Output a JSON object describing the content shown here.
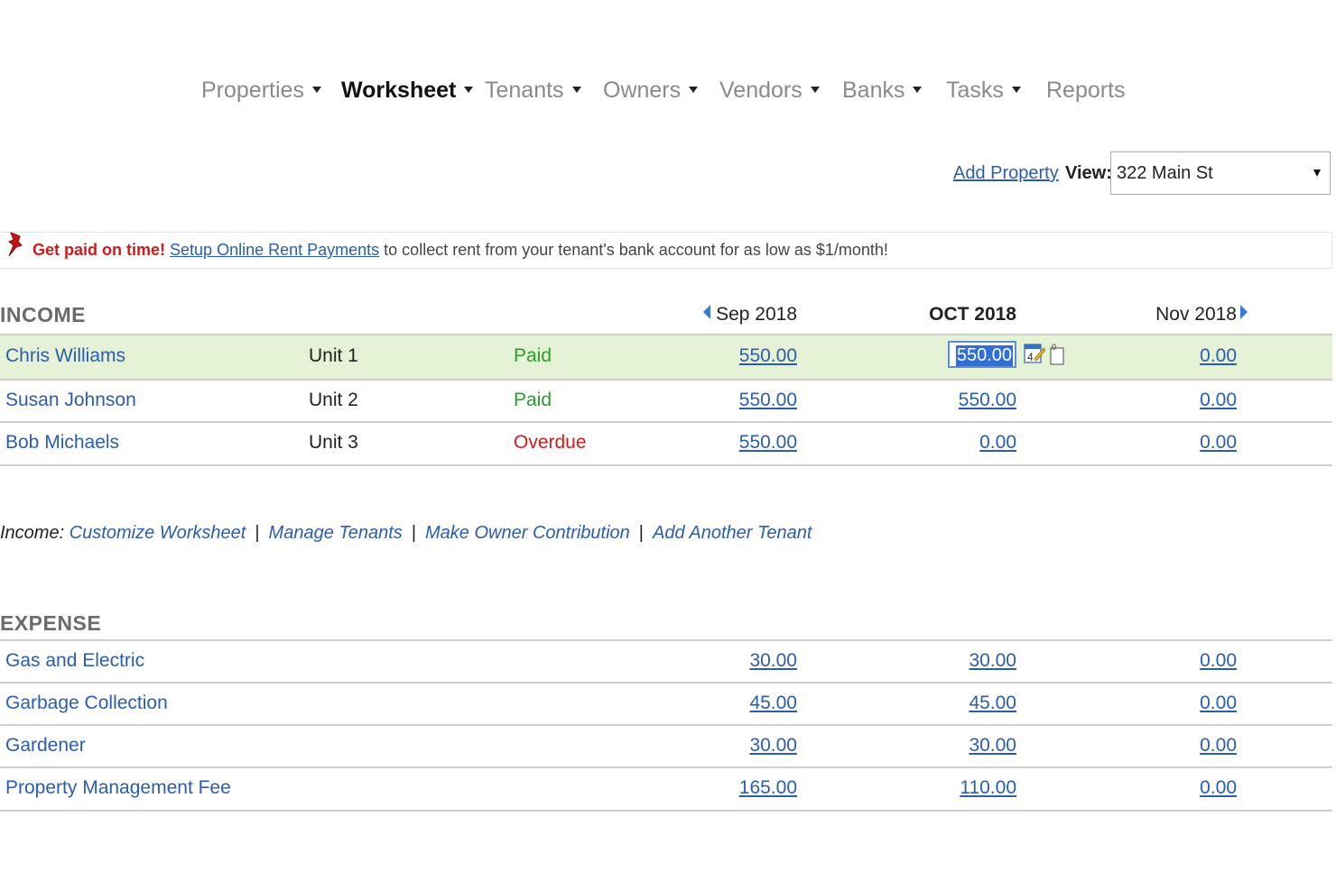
{
  "nav": {
    "items": [
      {
        "label": "Properties",
        "dropdown": true,
        "active": false
      },
      {
        "label": "Worksheet",
        "dropdown": true,
        "active": true
      },
      {
        "label": "Tenants",
        "dropdown": true,
        "active": false
      },
      {
        "label": "Owners",
        "dropdown": true,
        "active": false
      },
      {
        "label": "Vendors",
        "dropdown": true,
        "active": false
      },
      {
        "label": "Banks",
        "dropdown": true,
        "active": false
      },
      {
        "label": "Tasks",
        "dropdown": true,
        "active": false
      },
      {
        "label": "Reports",
        "dropdown": false,
        "active": false
      }
    ]
  },
  "toolbar": {
    "add_property": "Add Property",
    "view_label": "View:",
    "view_value": "322 Main St"
  },
  "banner": {
    "strong": "Get paid on time!",
    "link": "Setup Online Rent Payments",
    "rest": " to collect rent from your tenant's bank account for as low as $1/month!"
  },
  "income": {
    "title": "INCOME",
    "months": {
      "prev": "Sep 2018",
      "current": "OCT 2018",
      "next": "Nov 2018"
    },
    "rows": [
      {
        "name": "Chris Williams",
        "unit": "Unit 1",
        "status": "Paid",
        "sep": "550.00",
        "oct": "550.00",
        "nov": "0.00",
        "calendar_day": "4",
        "doc_count": "0"
      },
      {
        "name": "Susan Johnson",
        "unit": "Unit 2",
        "status": "Paid",
        "sep": "550.00",
        "oct": "550.00",
        "nov": "0.00"
      },
      {
        "name": "Bob Michaels",
        "unit": "Unit 3",
        "status": "Overdue",
        "sep": "550.00",
        "oct": "0.00",
        "nov": "0.00"
      }
    ],
    "links": {
      "prefix": "Income:",
      "items": [
        "Customize Worksheet",
        "Manage Tenants",
        "Make Owner Contribution",
        "Add Another Tenant"
      ],
      "separator": "|"
    }
  },
  "expense": {
    "title": "EXPENSE",
    "rows": [
      {
        "name": "Gas and Electric",
        "sep": "30.00",
        "oct": "30.00",
        "nov": "0.00"
      },
      {
        "name": "Garbage Collection",
        "sep": "45.00",
        "oct": "45.00",
        "nov": "0.00"
      },
      {
        "name": "Gardener",
        "sep": "30.00",
        "oct": "30.00",
        "nov": "0.00"
      },
      {
        "name": "Property Management Fee",
        "sep": "165.00",
        "oct": "110.00",
        "nov": "0.00"
      }
    ]
  },
  "colors": {
    "link": "#2a5db0",
    "paid": "#2a9d2a",
    "overdue": "#d11a1a",
    "row_highlight": "#e6f2d6"
  }
}
